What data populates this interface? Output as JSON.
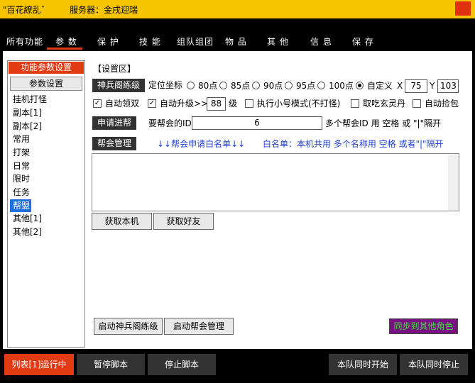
{
  "title_bar": {
    "app_title": "\"百花繚乱ˇ",
    "server": "服务器：金戌迎瑞"
  },
  "tabs": [
    "所有功能",
    "参  数",
    "保  护",
    "技  能",
    "组队组团",
    "物  品",
    "其  他",
    "信  息",
    "保  存"
  ],
  "active_tab": 1,
  "sidebar": {
    "title": "功能参数设置",
    "button": "参数设置",
    "items": [
      "挂机打怪",
      "副本[1]",
      "副本[2]",
      "常用",
      "打架",
      "日常",
      "限时",
      "任务",
      "帮盟",
      "其他[1]",
      "其他[2]"
    ],
    "selected": 8
  },
  "section_title": "【设置区】",
  "shenbing": {
    "label": "神兵阁练级",
    "pos_label": "定位坐标",
    "options": [
      "80点",
      "85点",
      "90点",
      "95点",
      "100点",
      "自定义"
    ],
    "selected": "自定义",
    "x_label": "X",
    "x_value": "75",
    "y_label": "Y",
    "y_value": "103"
  },
  "checks": {
    "auto_double": "自动领双",
    "auto_upgrade": "自动升级>>",
    "level_value": "88",
    "level_unit": "级",
    "small_mode": "执行小号模式(不打怪)",
    "eat_pill": "取吃玄灵丹",
    "auto_pick": "自动捡包"
  },
  "join_guild": {
    "label": "申请进帮",
    "id_label": "要帮会的ID",
    "id_value": "6",
    "hint": "多个帮会ID 用 空格 或 \"|\"隔开"
  },
  "guild_mgmt": {
    "label": "帮会管理",
    "arrow_text": "↓↓帮会申请白名单↓↓",
    "whitelist_hint": "白名单：本机共用 多个名称用 空格 或者\"|\"隔开"
  },
  "buttons": {
    "get_local": "获取本机",
    "get_friends": "获取好友",
    "start_shenbing": "启动神兵阁练级",
    "start_guild": "启动帮会管理",
    "sync": "同步到其他角色"
  },
  "bottom": {
    "list_running": "列表[1]运行中",
    "pause": "暂停脚本",
    "stop": "停止脚本",
    "team_start": "本队同时开始",
    "team_stop": "本队同时停止"
  }
}
